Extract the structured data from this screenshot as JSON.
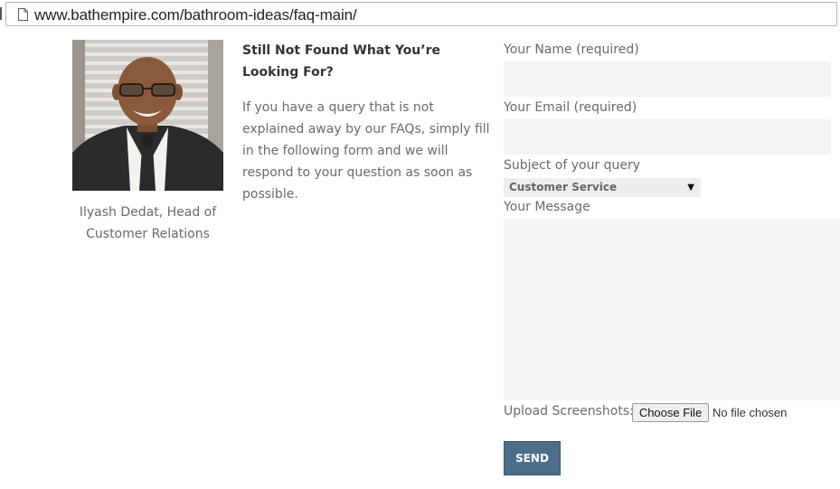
{
  "browser": {
    "url": "www.bathempire.com/bathroom-ideas/faq-main/"
  },
  "profile": {
    "photo_alt": "Ilyash Dedat portrait",
    "caption": "Ilyash Dedat, Head of Customer Relations"
  },
  "intro": {
    "title": "Still Not Found What You’re Looking For?",
    "body": "If you have a query that is not explained away by our FAQs,  simply fill in the following form and we will respond to your question as soon as possible."
  },
  "form": {
    "name_label": "Your Name (required)",
    "email_label": "Your Email (required)",
    "subject_label": "Subject of your query",
    "subject_selected": "Customer Service",
    "message_label": "Your Message",
    "upload_label": "Upload Screenshots:",
    "file_button": "Choose File",
    "file_status": "No file chosen",
    "send_label": "SEND"
  },
  "colors": {
    "field_bg": "#f4f4f4",
    "send_bg": "#4d6e88",
    "text_muted": "#6a6a6a"
  }
}
